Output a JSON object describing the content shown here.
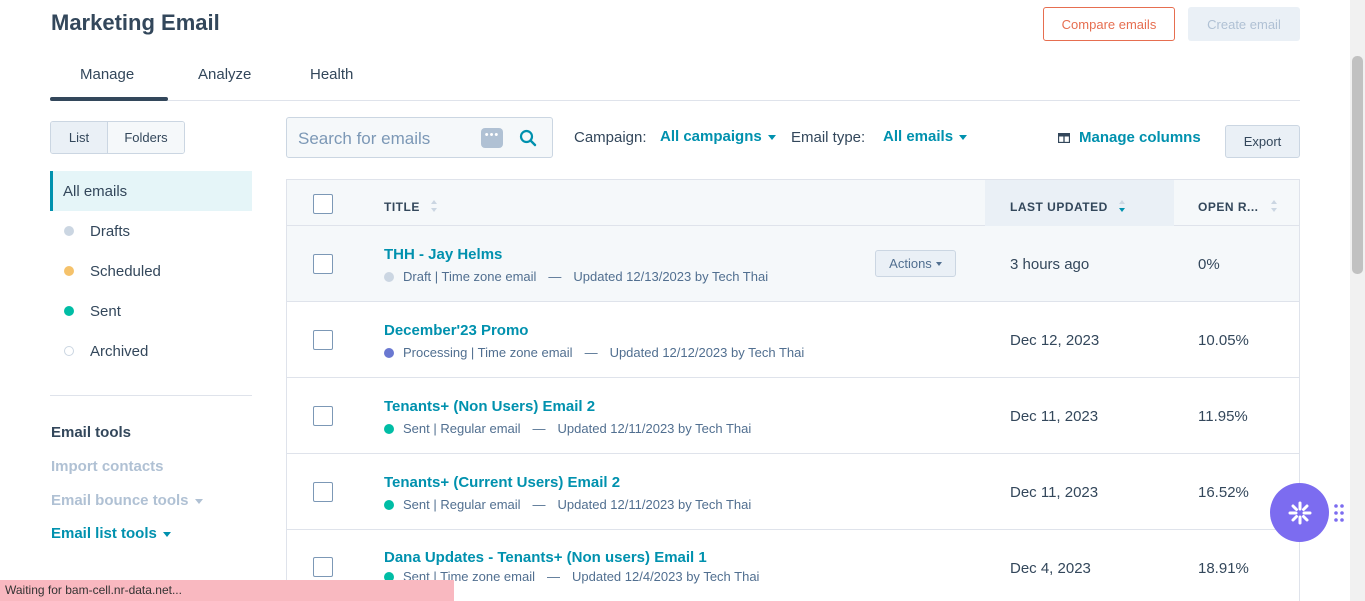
{
  "header": {
    "title": "Marketing Email",
    "compare_label": "Compare emails",
    "create_label": "Create email"
  },
  "tabs": [
    {
      "label": "Manage"
    },
    {
      "label": "Analyze"
    },
    {
      "label": "Health"
    }
  ],
  "view_toggle": {
    "list": "List",
    "folders": "Folders"
  },
  "sidebar": {
    "items": [
      {
        "label": "All emails"
      },
      {
        "label": "Drafts",
        "dot_color": "#cbd6e2"
      },
      {
        "label": "Scheduled",
        "dot_color": "#f5c26b"
      },
      {
        "label": "Sent",
        "dot_color": "#00bda5"
      },
      {
        "label": "Archived",
        "dot_color": "hollow"
      }
    ],
    "tools_title": "Email tools",
    "tools": [
      {
        "label": "Import contacts"
      },
      {
        "label": "Email bounce tools"
      },
      {
        "label": "Email list tools"
      }
    ]
  },
  "search": {
    "placeholder": "Search for emails",
    "icon": "search-icon"
  },
  "filters": {
    "campaign_label": "Campaign:",
    "campaign_value": "All campaigns",
    "type_label": "Email type:",
    "type_value": "All emails",
    "manage_columns": "Manage columns",
    "export": "Export"
  },
  "table": {
    "columns": {
      "title": "TITLE",
      "last_updated": "LAST UPDATED",
      "open_rate": "OPEN R..."
    },
    "actions_label": "Actions",
    "rows": [
      {
        "title": "THH - Jay Helms",
        "status": "Draft | Time zone email",
        "status_color": "#cbd6e2",
        "updated": "Updated 12/13/2023 by Tech Thai",
        "last_updated": "3 hours ago",
        "open_rate": "0%"
      },
      {
        "title": "December'23 Promo",
        "status": "Processing | Time zone email",
        "status_color": "#6a78d1",
        "updated": "Updated 12/12/2023 by Tech Thai",
        "last_updated": "Dec 12, 2023",
        "open_rate": "10.05%"
      },
      {
        "title": "Tenants+ (Non Users) Email 2",
        "status": "Sent | Regular email",
        "status_color": "#00bda5",
        "updated": "Updated 12/11/2023 by Tech Thai",
        "last_updated": "Dec 11, 2023",
        "open_rate": "11.95%"
      },
      {
        "title": "Tenants+ (Current Users) Email 2",
        "status": "Sent | Regular email",
        "status_color": "#00bda5",
        "updated": "Updated 12/11/2023 by Tech Thai",
        "last_updated": "Dec 11, 2023",
        "open_rate": "16.52%"
      },
      {
        "title": "Dana Updates - Tenants+ (Non users) Email 1",
        "status": "Sent | Time zone email",
        "status_color": "#00bda5",
        "updated": "Updated 12/4/2023 by Tech Thai",
        "last_updated": "Dec 4, 2023",
        "open_rate": "18.91%"
      }
    ]
  },
  "status_bar": "Waiting for bam-cell.nr-data.net..."
}
